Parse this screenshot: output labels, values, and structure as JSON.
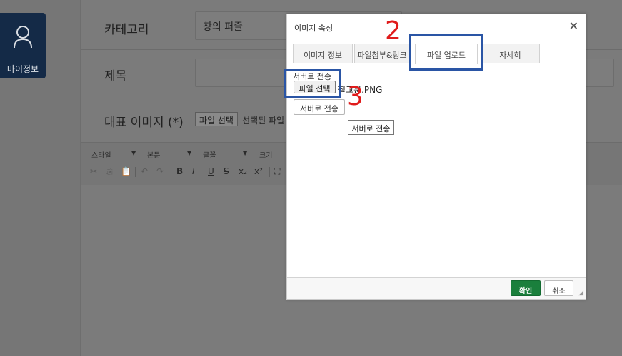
{
  "sidebar": {
    "mypage_label": "마이정보",
    "icon": "user-icon"
  },
  "form": {
    "category_label": "카테고리",
    "category_value": "창의 퍼즐",
    "title_label": "제목",
    "title_value": "",
    "image_label": "대표 이미지 (*)",
    "image_file_button": "파일 선택",
    "image_file_text": "선택된 파일 '"
  },
  "toolbar": {
    "style": "스타일",
    "paragraph": "본문",
    "font": "글꼴",
    "size": "크기",
    "buttons": [
      "✂",
      "⎘",
      "📋",
      "↶",
      "↷",
      "B",
      "I",
      "U",
      "S",
      "x₂",
      "x²",
      "⛶"
    ]
  },
  "dialog": {
    "title": "이미지 속성",
    "close": "×",
    "tabs": [
      "이미지 정보",
      "파일첨부&링크",
      "파일 업로드",
      "자세히"
    ],
    "active_tab": "파일 업로드",
    "upload_label": "서버로 전송",
    "file_choose": "파일 선택",
    "file_name": "칠교문.PNG",
    "send_button": "서버로 전송",
    "tooltip": "서버로 전송",
    "ok": "확인",
    "cancel": "취소"
  },
  "annotations": {
    "step2": "2",
    "step3": "3",
    "color": "#e01b1b",
    "box_color": "#2a55a5"
  }
}
